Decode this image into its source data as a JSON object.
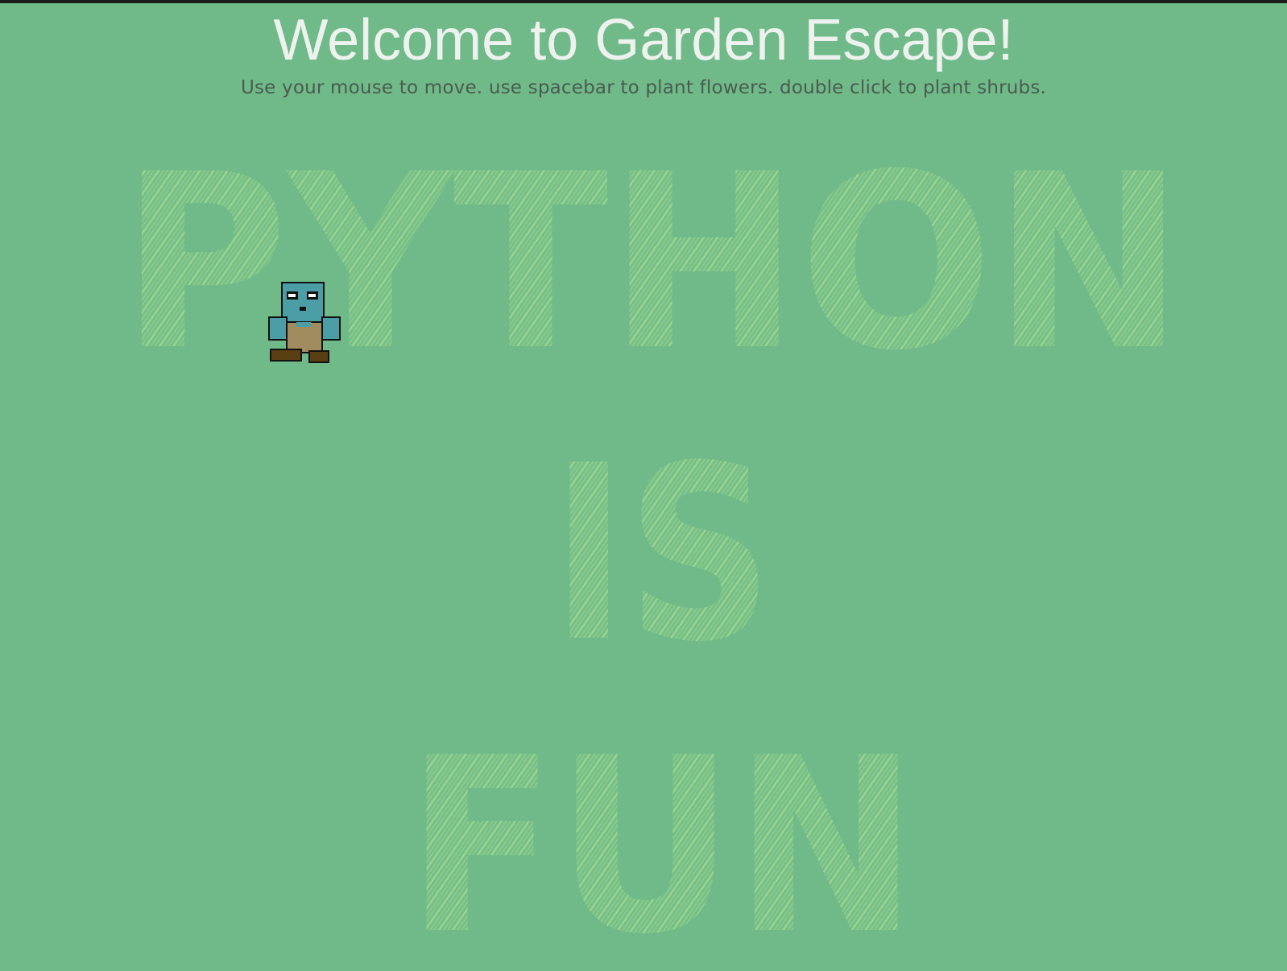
{
  "game": {
    "title": "Welcome to Garden Escape!",
    "instructions": "Use your mouse to move. use spacebar to plant flowers. double click to plant shrubs.",
    "garden_words": [
      "PYTHON",
      "IS",
      "FUN"
    ],
    "colors": {
      "grass": "#6fba88",
      "scribble": "#98d48a",
      "title_text": "#eef2ee",
      "instruction_text": "#4b5b50",
      "player_skin": "#4b9da6",
      "player_overalls": "#a08c5e",
      "player_boots": "#5a3e14"
    },
    "player": {
      "icon": "gardener-sprite-icon"
    }
  }
}
